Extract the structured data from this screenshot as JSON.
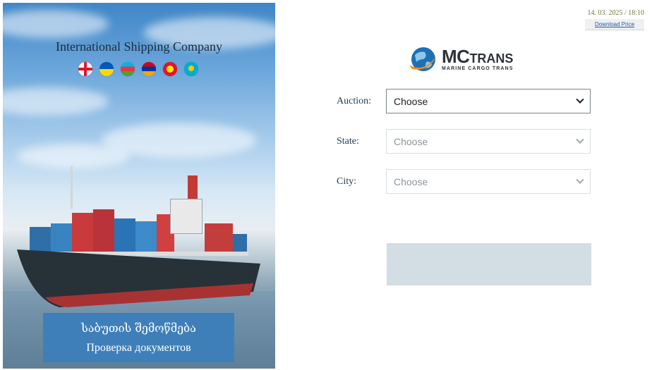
{
  "hero": {
    "title": "International Shipping Company",
    "flags": [
      "georgia-flag",
      "ukraine-flag",
      "azerbaijan-flag",
      "armenia-flag",
      "kyrgyzstan-flag",
      "kazakhstan-flag"
    ],
    "documents_box": {
      "line1": "საბუთის შემოწმება",
      "line2": "Проверка документов"
    }
  },
  "header": {
    "datetime": "14. 03. 2025 / 18:10",
    "download_label": "Download Price"
  },
  "logo": {
    "main_big": "MC",
    "main_small": "TRANS",
    "subtitle": "MARINE CARGO TRANS"
  },
  "form": {
    "auction": {
      "label": "Auction:",
      "value": "Choose"
    },
    "state": {
      "label": "State:",
      "value": "Choose"
    },
    "city": {
      "label": "City:",
      "value": "Choose"
    }
  },
  "colors": {
    "accent_blue": "#3e7fba",
    "result_box": "#d3dde4",
    "label_color": "#1f3b55"
  }
}
